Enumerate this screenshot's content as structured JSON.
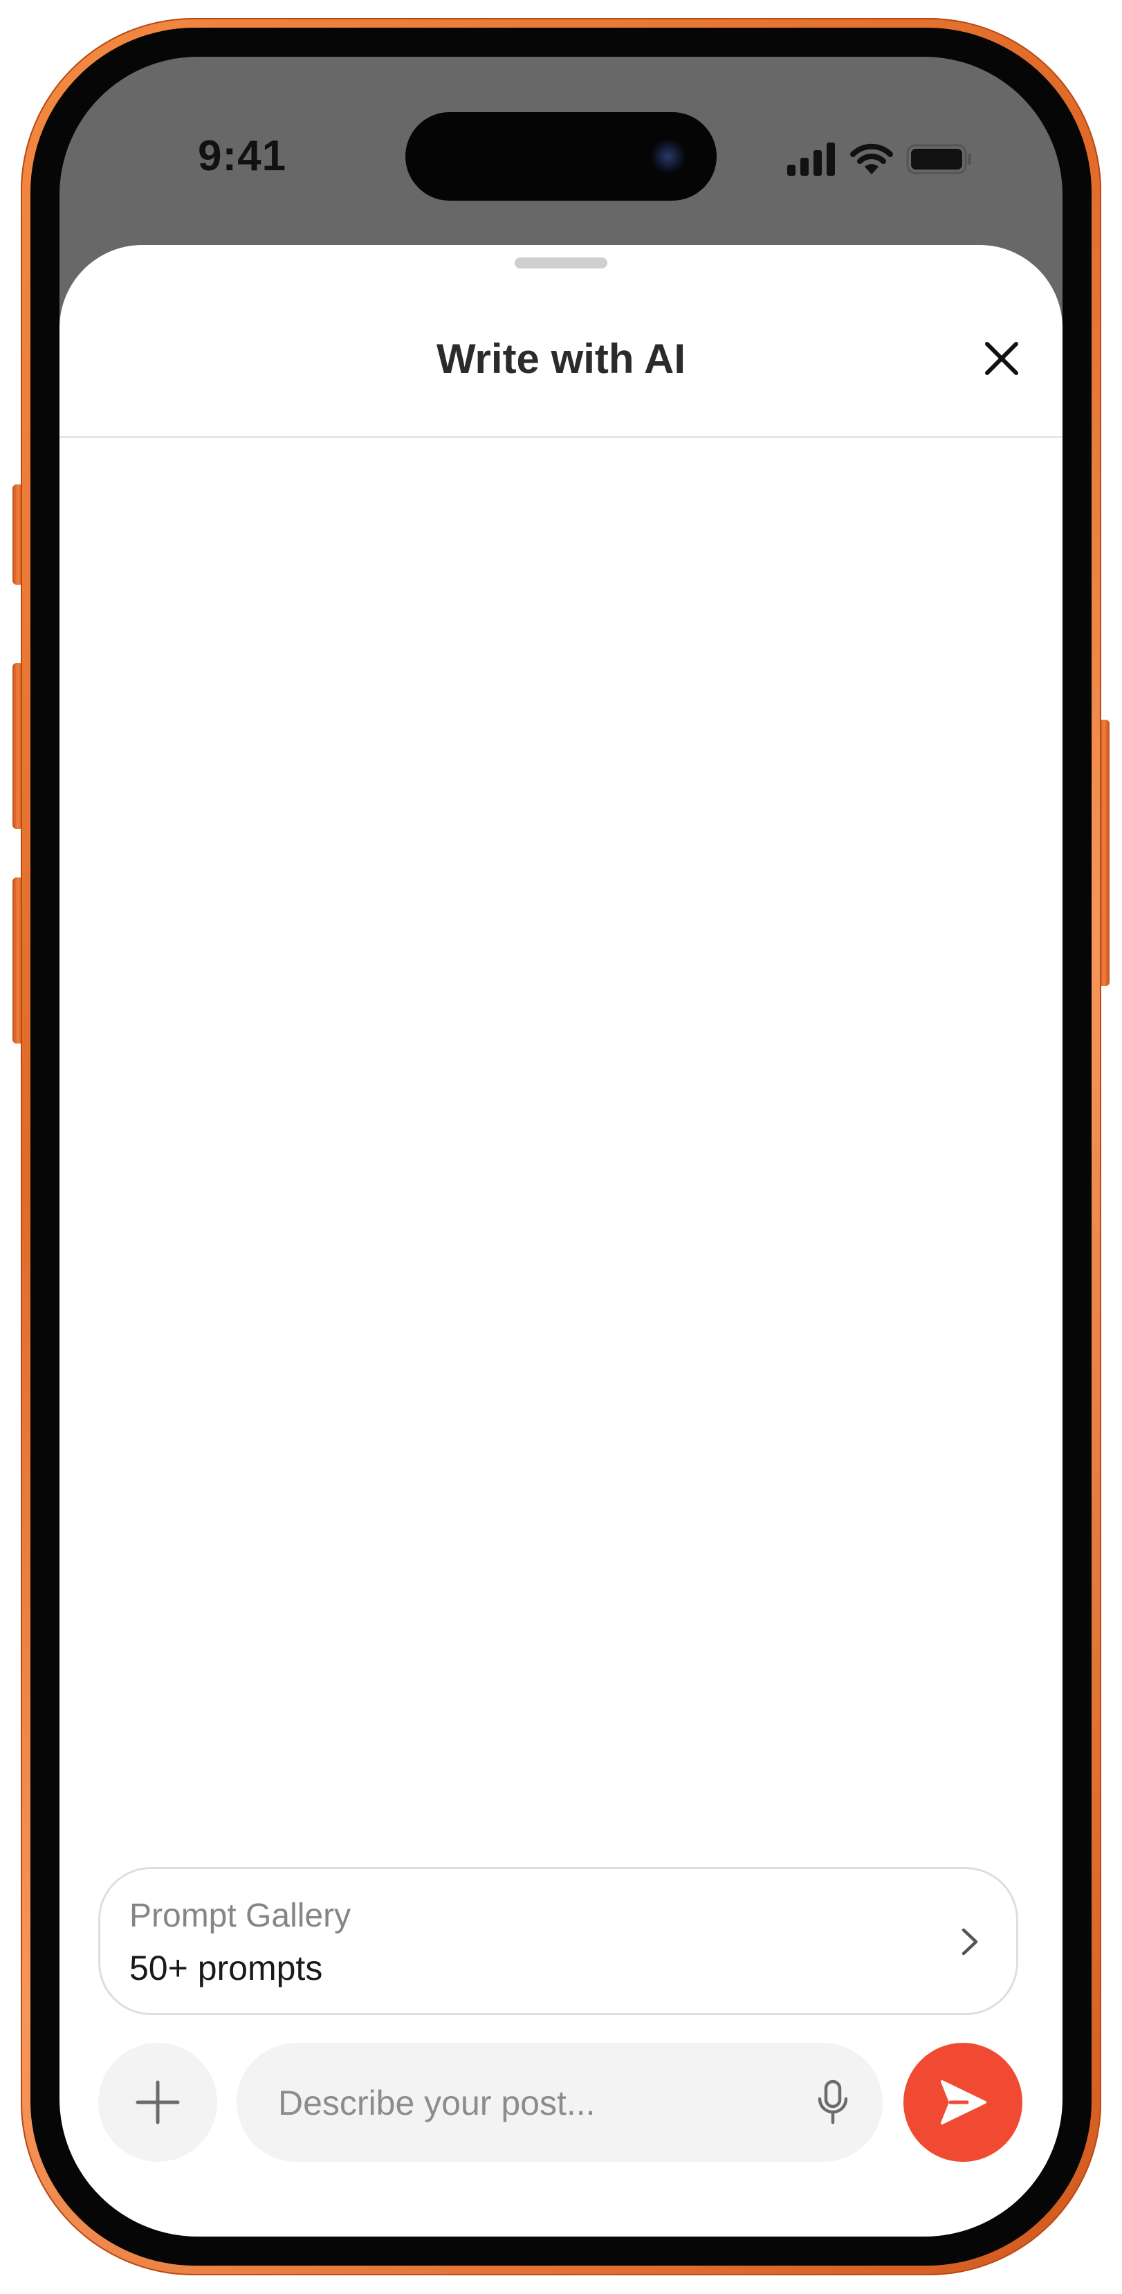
{
  "status_bar": {
    "time": "9:41",
    "signal_icon": "cellular-signal-icon",
    "wifi_icon": "wifi-icon",
    "battery_icon": "battery-icon"
  },
  "sheet": {
    "title": "Write with AI",
    "close_icon": "close-icon"
  },
  "prompt_gallery": {
    "label": "Prompt Gallery",
    "count": "50+ prompts",
    "chevron_icon": "chevron-right-icon"
  },
  "composer": {
    "placeholder": "Describe your post...",
    "value": "",
    "add_icon": "plus-icon",
    "mic_icon": "microphone-icon",
    "send_icon": "send-icon"
  },
  "colors": {
    "frame": "#E8742F",
    "send_button": "#F14A32",
    "input_background": "#F3F3F3"
  }
}
